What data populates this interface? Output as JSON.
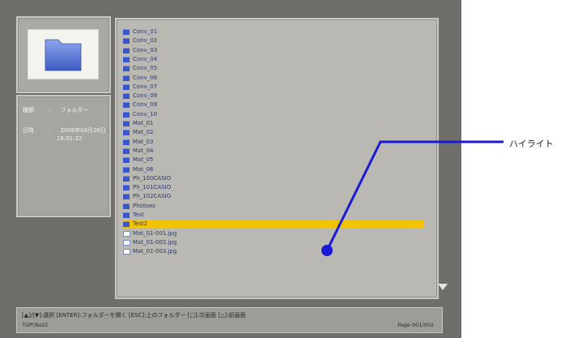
{
  "info": {
    "type_label": "種類",
    "type_value": "フォルダー",
    "date_label": "日時",
    "date_value": "2006年04月26日",
    "time_value": "18:01:32",
    "separator": ":"
  },
  "file_list": [
    {
      "name": "Conv_01",
      "kind": "folder"
    },
    {
      "name": "Conv_02",
      "kind": "folder"
    },
    {
      "name": "Conv_03",
      "kind": "folder"
    },
    {
      "name": "Conv_04",
      "kind": "folder"
    },
    {
      "name": "Conv_05",
      "kind": "folder"
    },
    {
      "name": "Conv_06",
      "kind": "folder"
    },
    {
      "name": "Conv_07",
      "kind": "folder"
    },
    {
      "name": "Conv_08",
      "kind": "folder"
    },
    {
      "name": "Conv_09",
      "kind": "folder"
    },
    {
      "name": "Conv_10",
      "kind": "folder"
    },
    {
      "name": "Mat_01",
      "kind": "folder"
    },
    {
      "name": "Mat_02",
      "kind": "folder"
    },
    {
      "name": "Mat_03",
      "kind": "folder"
    },
    {
      "name": "Mat_04",
      "kind": "folder"
    },
    {
      "name": "Mat_05",
      "kind": "folder"
    },
    {
      "name": "Mat_06",
      "kind": "folder"
    },
    {
      "name": "Ph_100CASIO",
      "kind": "folder"
    },
    {
      "name": "Ph_101CASIO",
      "kind": "folder"
    },
    {
      "name": "Ph_102CASIO",
      "kind": "folder"
    },
    {
      "name": "Photoes",
      "kind": "folder"
    },
    {
      "name": "Test",
      "kind": "folder"
    },
    {
      "name": "Test2",
      "kind": "folder",
      "selected": true
    },
    {
      "name": "Mat_01-001.jpg",
      "kind": "file"
    },
    {
      "name": "Mat_01-002.jpg",
      "kind": "file"
    },
    {
      "name": "Mat_01-003.jpg",
      "kind": "file"
    }
  ],
  "status": {
    "help": "[▲]/[▼]:選択 [ENTER]:フォルダーを開く [ESC]:上のフォルダー [□]:次画面 [△]:前画面",
    "path": "TOP\\Test2",
    "page": "Page 001/002"
  },
  "annotation": {
    "label": "ハイライト",
    "line_color": "#1a1ad6"
  }
}
